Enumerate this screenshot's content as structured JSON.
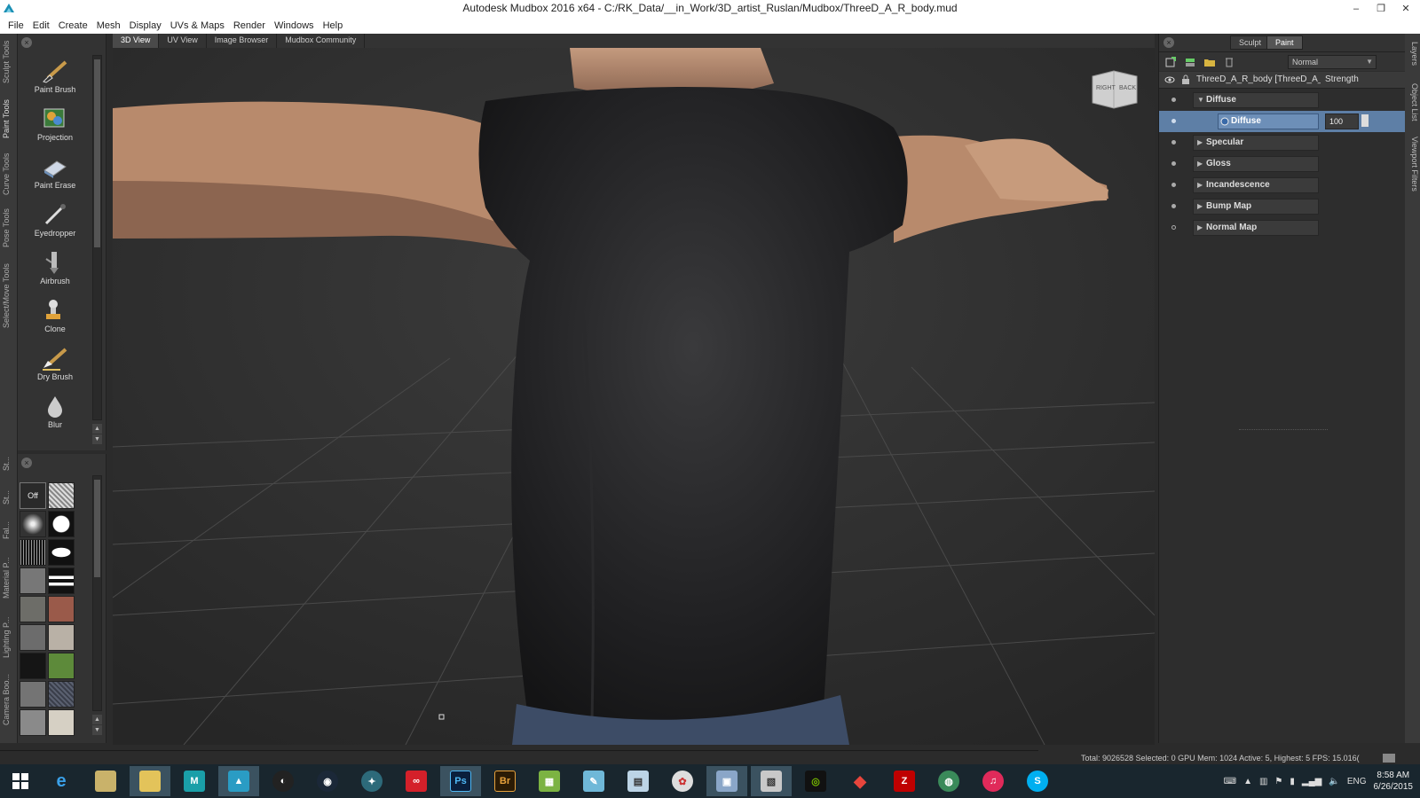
{
  "window": {
    "title": "Autodesk Mudbox 2016 x64 - C:/RK_Data/__in_Work/3D_artist_Ruslan/Mudbox/ThreeD_A_R_body.mud",
    "controls": [
      "–",
      "❐",
      "✕"
    ]
  },
  "menu": [
    "File",
    "Edit",
    "Create",
    "Mesh",
    "Display",
    "UVs & Maps",
    "Render",
    "Windows",
    "Help"
  ],
  "left_tray_tabs": [
    "Sculpt Tools",
    "Paint Tools",
    "Curve Tools",
    "Pose Tools",
    "Select/Move Tools",
    "St...",
    "St...",
    "Fal...",
    "Material P...",
    "Lighting P...",
    "Camera Boo..."
  ],
  "paint_tools": [
    {
      "label": "Paint Brush",
      "icon": "paint-brush-icon"
    },
    {
      "label": "Projection",
      "icon": "projection-icon"
    },
    {
      "label": "Paint Erase",
      "icon": "paint-erase-icon"
    },
    {
      "label": "Eyedropper",
      "icon": "eyedropper-icon"
    },
    {
      "label": "Airbrush",
      "icon": "airbrush-icon"
    },
    {
      "label": "Clone",
      "icon": "clone-icon"
    },
    {
      "label": "Dry Brush",
      "icon": "dry-brush-icon"
    },
    {
      "label": "Blur",
      "icon": "blur-icon"
    }
  ],
  "stamps": {
    "off_label": "Off"
  },
  "viewport_tabs": [
    "3D View",
    "UV View",
    "Image Browser",
    "Mudbox Community"
  ],
  "viewcube": {
    "right": "RIGHT",
    "back": "BACK"
  },
  "right_panel": {
    "sculpt_label": "Sculpt",
    "paint_label": "Paint",
    "blend_mode": "Normal",
    "header_name": "ThreeD_A_R_body [ThreeD_A_R_",
    "header_strength": "Strength",
    "layers": [
      {
        "name": "Diffuse",
        "expanded": true,
        "visible": true
      },
      {
        "name": "Diffuse",
        "child": true,
        "selected": true,
        "strength": "100"
      },
      {
        "name": "Specular",
        "expanded": false,
        "visible": true
      },
      {
        "name": "Gloss",
        "expanded": false,
        "visible": true
      },
      {
        "name": "Incandescence",
        "expanded": false,
        "visible": true
      },
      {
        "name": "Bump Map",
        "expanded": false,
        "visible": true
      },
      {
        "name": "Normal Map",
        "expanded": false,
        "visible": false
      }
    ]
  },
  "right_vertical_tabs": [
    "Layers",
    "Object List",
    "Viewport Filters"
  ],
  "status": {
    "text": "Total: 9026528  Selected: 0 GPU Mem: 1024  Active: 5, Highest: 5  FPS: 15.016("
  },
  "taskbar": {
    "apps": [
      "start",
      "ie",
      "explorer-old",
      "file-explorer",
      "maya",
      "mudbox",
      "obs",
      "steam",
      "3ds",
      "creative-cloud",
      "Ps",
      "Br",
      "sheets",
      "notes",
      "calculator",
      "tool",
      "remote",
      "viewer",
      "nvidia",
      "git",
      "filezilla",
      "globe",
      "itunes",
      "skype"
    ],
    "lang": "ENG",
    "time": "8:58 AM",
    "date": "6/26/2015"
  },
  "colors": {
    "selection": "#5e7fa6",
    "panel": "#2d2d2d",
    "viewport_bg": "#2e2e2e",
    "taskbar": "#19262e"
  }
}
